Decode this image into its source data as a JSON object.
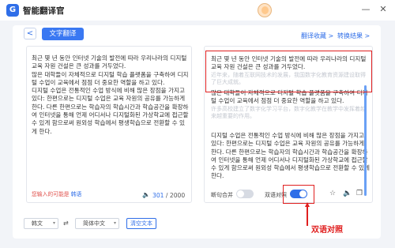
{
  "app": {
    "title": "智能翻译官",
    "logo_text": "G"
  },
  "window": {
    "minimize": "—",
    "close": "✕"
  },
  "toolbar": {
    "back_icon": "chevron-left-icon",
    "back_glyph": "<",
    "active_tab": "文字翻译",
    "favorites_link": "翻译收藏 >",
    "results_link": "转换结果 >"
  },
  "source": {
    "paragraphs": [
      "최근 몇 년 동안 인터넷 기술의 발전에 따라 우리나라의 디지털 교육 자원 건설은 큰 성과를 거두었다.",
      "많은 대학들이 자체적으로 디지털 학습 플랫폼을 구축하여 디지털 수업이 교육에서 점점 더 중요한 역할을 하고 있다.",
      "디지털 수업은 전통적인 수업 방식에 비해 많은 장점을 가지고 있다: 한편으로는 디지털 수업은 교육 자원의 공유를 가능하게 한다. 다른 한편으로는 학습자의 학습시간과 학습공간을 확장하여 인터넷을 통해 언제 어디서나 디지털화된 가상학교에 접근할 수 있게 함으로써 원외성 학습에서 평생학습으로 전환할 수 있게 한다."
    ],
    "hint_text": "您输入的可能是",
    "hint_link": "韩语",
    "char_count": "301",
    "char_total": " / 2000"
  },
  "translation": {
    "blocks": [
      {
        "text": "최근 몇 년 동안 인터넷 기술의 발전에 따라 우리나라의 디지털 교육 자원 건설은 큰 성과를 거두었다.",
        "sub": "近年来，随着互联网技术的发展，我国数字化教育资源建设取得了巨大成就。"
      },
      {
        "text": "많은 대학들이 자체적으로 디지털 학습 플랫폼을 구축하여 디지털 수업이 교육에서 점점 더 중요한 역할을 하고 있다.",
        "sub": "许多高校建立了数字化学习平台，数字化教学在教学中发挥着越来越重要的作用。"
      },
      {
        "text": "디지털 수업은 전통적인 수업 방식에 비해 많은 장점을 가지고 있다: 한편으로는 디지털 수업은 교육 자원의 공유를 가능하게 한다. 다른 한편으로는 학습자의 학습시간과 학습공간을 확장하여 인터넷을 통해 언제 어디서나 디지털화된 가상학교에 접근할 수 있게 함으로써 원외성 학습에서 평생학습으로 전환할 수 있게 한다.",
        "sub": ""
      }
    ],
    "split_merge_label": "断句合并",
    "bilingual_label": "双语对照",
    "bilingual_on": true,
    "split_merge_on": false
  },
  "annotation": {
    "label": "双语对照",
    "color": "#e02020"
  },
  "bottom": {
    "source_lang": "韩文",
    "target_lang": "简体中文",
    "clear_label": "清空文本"
  },
  "colors": {
    "accent": "#2f6ee8",
    "annotation": "#e02020"
  }
}
